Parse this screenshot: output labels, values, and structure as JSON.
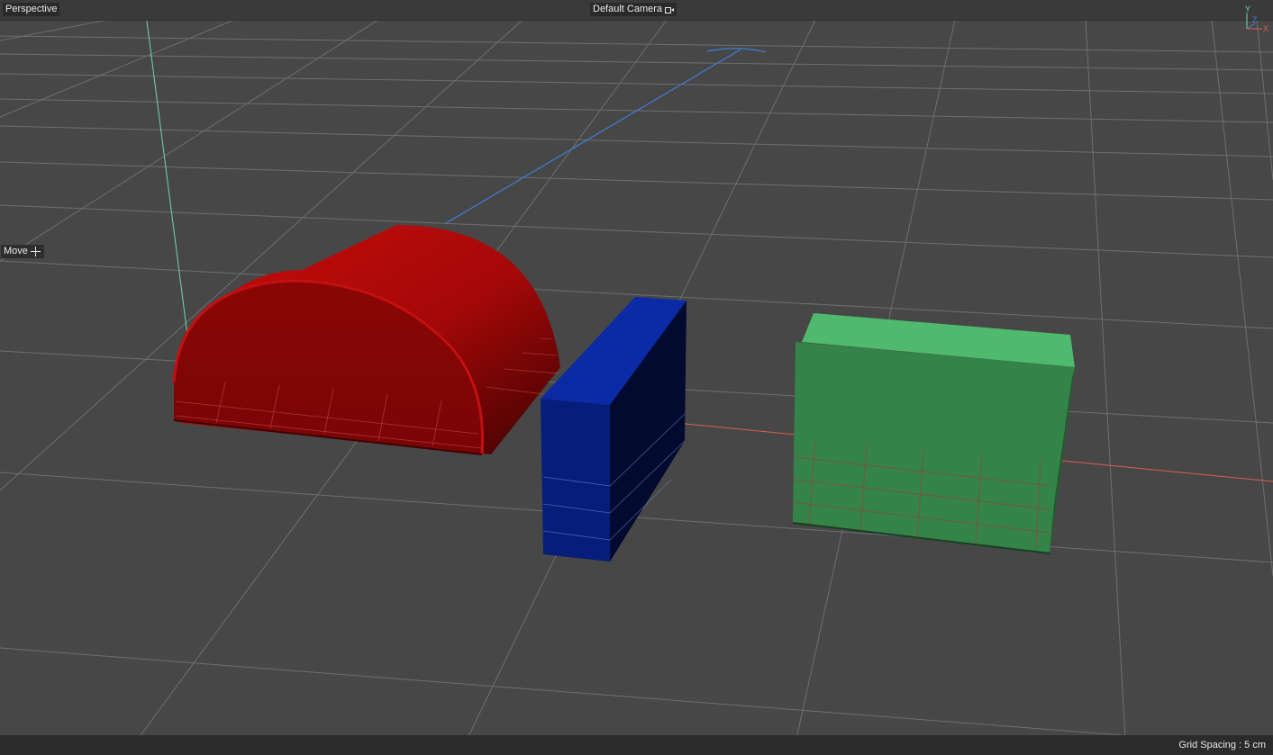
{
  "viewport": {
    "view_name": "Perspective",
    "camera_name": "Default Camera",
    "tool_label": "Move",
    "status": "Grid Spacing : 5 cm"
  },
  "axis_gizmo": {
    "y_label": "Y",
    "z_label": "Z",
    "x_label": "X"
  },
  "colors": {
    "background": "#474747",
    "grid_line": "#7a7a7a",
    "x_axis": "#d9604f",
    "y_axis": "#6ed6b0",
    "z_axis": "#3f7fd6",
    "half_cylinder": "#b00a0a",
    "blue_box": "#0a2a9a",
    "green_box": "#3f9c56"
  },
  "objects": [
    {
      "name": "Half Cylinder",
      "color": "red"
    },
    {
      "name": "Thin Box",
      "color": "blue"
    },
    {
      "name": "Box",
      "color": "green"
    }
  ]
}
